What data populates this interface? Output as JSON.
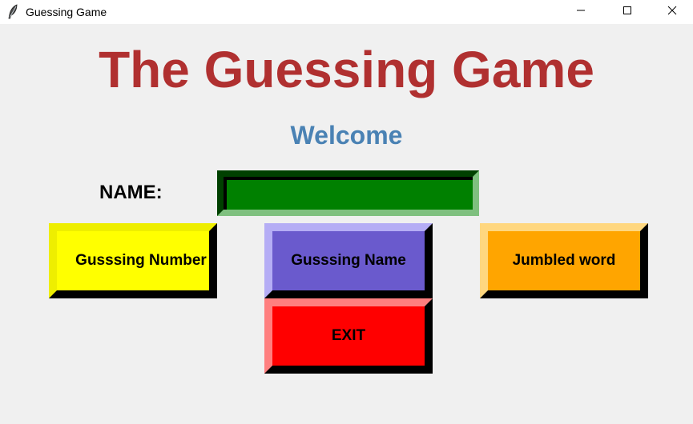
{
  "window": {
    "title": "Guessing Game",
    "icon": "feather-icon",
    "controls": [
      "minimize-icon",
      "maximize-icon",
      "close-icon"
    ]
  },
  "game": {
    "title": "The Guessing Game",
    "welcome": "Welcome",
    "name_label": "NAME:",
    "name_value": "",
    "buttons": {
      "number": "Gusssing Number",
      "name": "Gusssing Name",
      "jumbled": "Jumbled word",
      "exit": "EXIT"
    }
  },
  "colors": {
    "title": "#b03030",
    "welcome": "#4a82b4",
    "input_bg": "#008000",
    "btn_number": "#ffff00",
    "btn_name": "#6a5acd",
    "btn_jumbled": "#ffa500",
    "btn_exit": "#ff0000"
  }
}
